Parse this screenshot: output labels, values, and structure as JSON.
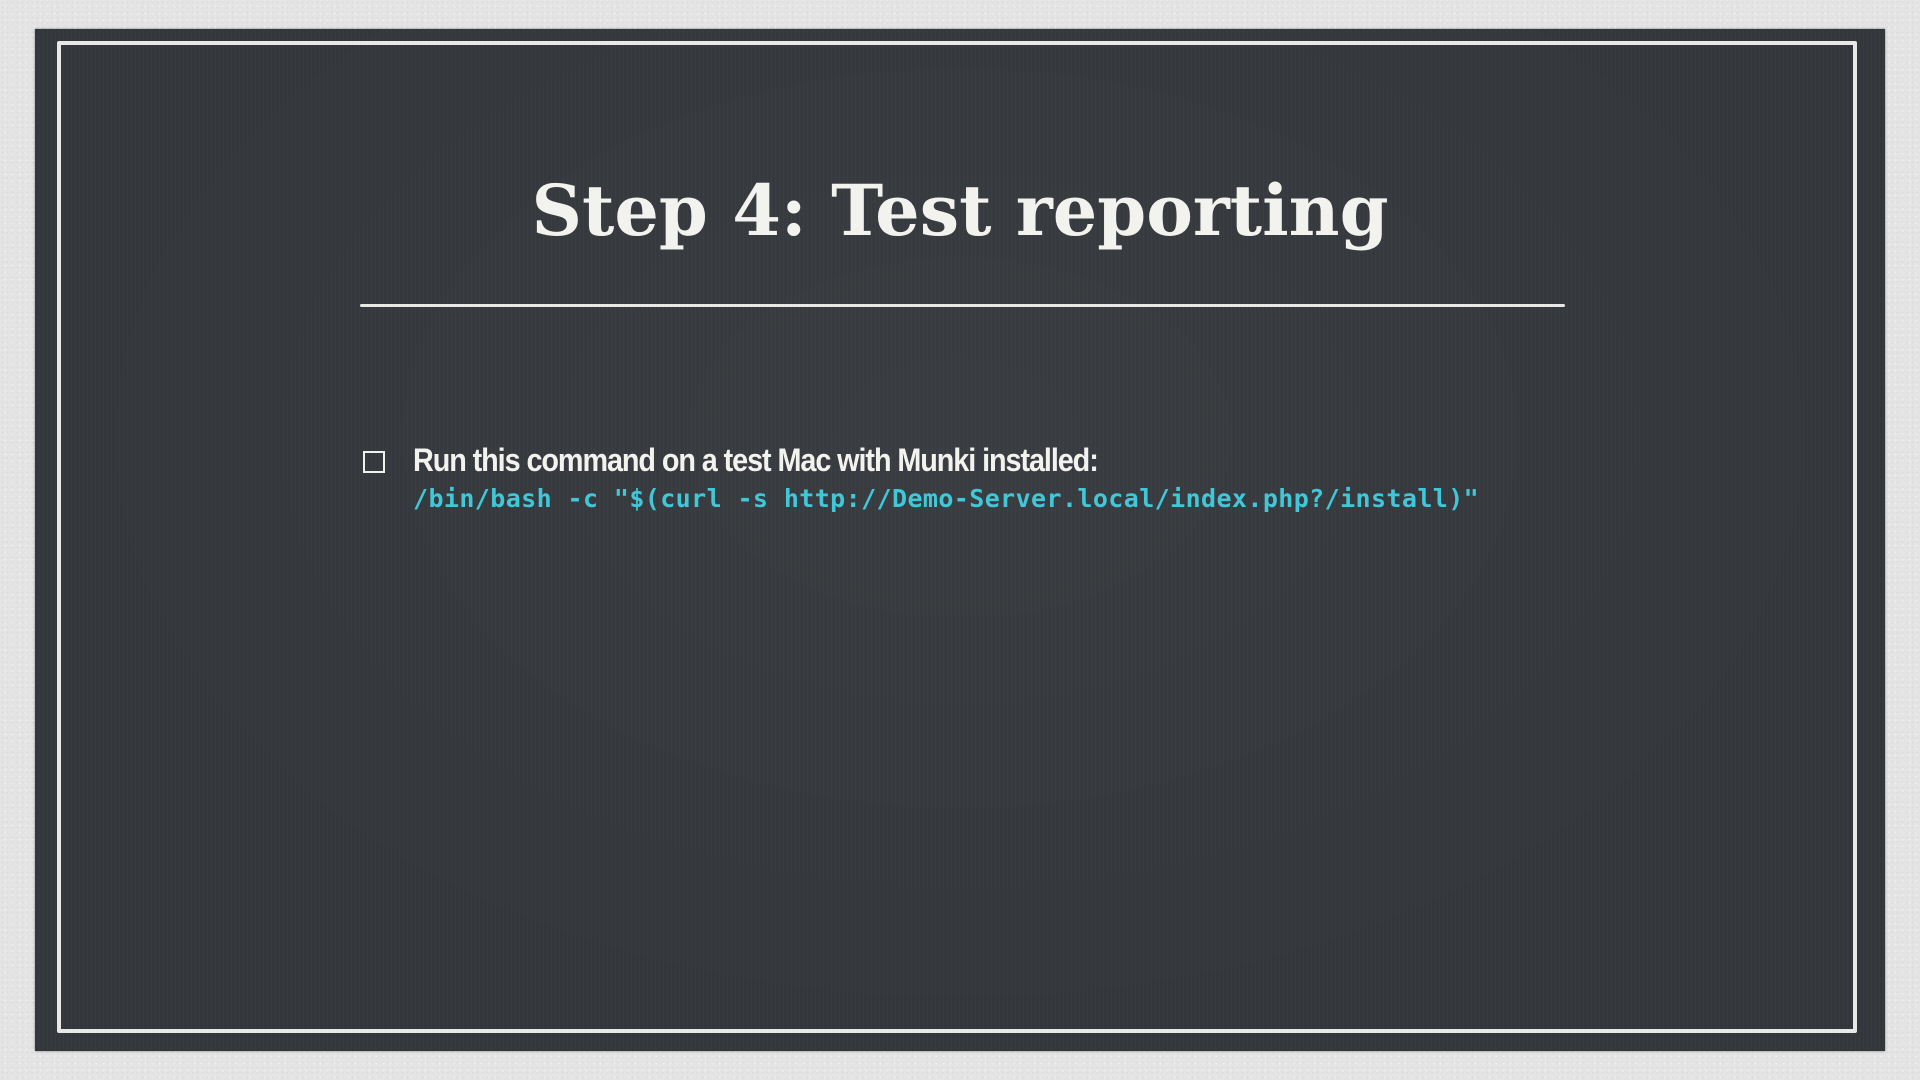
{
  "slide": {
    "title": "Step 4: Test reporting",
    "bullets": [
      {
        "text": "Run this command on a test Mac with Munki installed:",
        "command": "/bin/bash -c \"$(curl -s http://Demo-Server.local/index.php?/install)\""
      }
    ]
  },
  "colors": {
    "board": "#33373b",
    "frame": "#e8e8e6",
    "text": "#f2f2ef",
    "command": "#40c8d8"
  },
  "icons": {
    "bullet": "checkbox-icon"
  }
}
